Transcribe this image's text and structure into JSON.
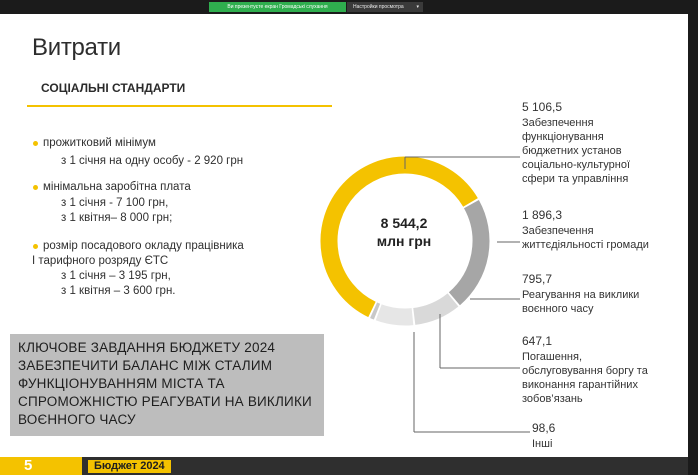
{
  "share_bar": {
    "status_text": "Ви презентуєте екран Громадські слухання",
    "options_label": "Настройки просмотра",
    "chevron": "▾"
  },
  "slide": {
    "title": "Витрати",
    "section_title": "СОЦІАЛЬНІ СТАНДАРТИ",
    "standards": [
      {
        "label": "прожитковий мінімум",
        "lines": [
          "з 1 січня на одну особу - 2 920 грн"
        ]
      },
      {
        "label": "мінімальна заробітна плата",
        "lines": [
          "з 1 січня - 7 100 грн,",
          "з 1 квітня– 8 000 грн;"
        ]
      },
      {
        "label": "розмір посадового окладу працівника",
        "label2": "І тарифного розряду ЄТС",
        "lines": [
          "з 1 січня – 3 195 грн,",
          "з 1 квітня – 3 600 грн."
        ]
      }
    ],
    "key_task": [
      "КЛЮЧОВЕ ЗАВДАННЯ БЮДЖЕТУ 2024",
      "ЗАБЕЗПЕЧИТИ БАЛАНС МІЖ СТАЛИМ",
      "ФУНКЦІОНУВАННЯМ МІСТА ТА",
      "СПРОМОЖНІСТЮ РЕАГУВАТИ НА ВИКЛИКИ",
      "ВОЄННОГО ЧАСУ"
    ],
    "footer": {
      "page_number": "5",
      "label": "Бюджет 2024"
    },
    "colors": {
      "accent": "#f4c200",
      "gray": "#a6a6a6",
      "light_gray": "#d9d9d9"
    }
  },
  "donut": {
    "total_value": "8 544,2",
    "total_unit": "млн грн",
    "segments": [
      {
        "value": "5 106,5",
        "label": "Забезпечення функціонування бюджетних установ соціально-культурної сфери та управління",
        "lines": [
          "Забезпечення",
          "функціонування",
          "бюджетних установ",
          "соціально-культурної",
          "сфери та управління"
        ],
        "color": "#f4c200"
      },
      {
        "value": "1 896,3",
        "label": "Забезпечення життєдіяльності громади",
        "lines": [
          "Забезпечення",
          "життєдіяльності громади"
        ],
        "color": "#a6a6a6"
      },
      {
        "value": "795,7",
        "label": "Реагування на виклики воєнного часу",
        "lines": [
          "Реагування на виклики",
          "воєнного часу"
        ],
        "color": "#d9d9d9"
      },
      {
        "value": "647,1",
        "label": "Погашення, обслуговування боргу та виконання гарантійних зобов'язань",
        "lines": [
          "Погашення,",
          "обслуговування боргу та",
          "виконання гарантійних",
          "зобов’язань"
        ],
        "color": "#e6e6e6"
      },
      {
        "value": "98,6",
        "label": "Інші",
        "lines": [
          "Інші"
        ],
        "color": "#c8c8c8"
      }
    ]
  }
}
